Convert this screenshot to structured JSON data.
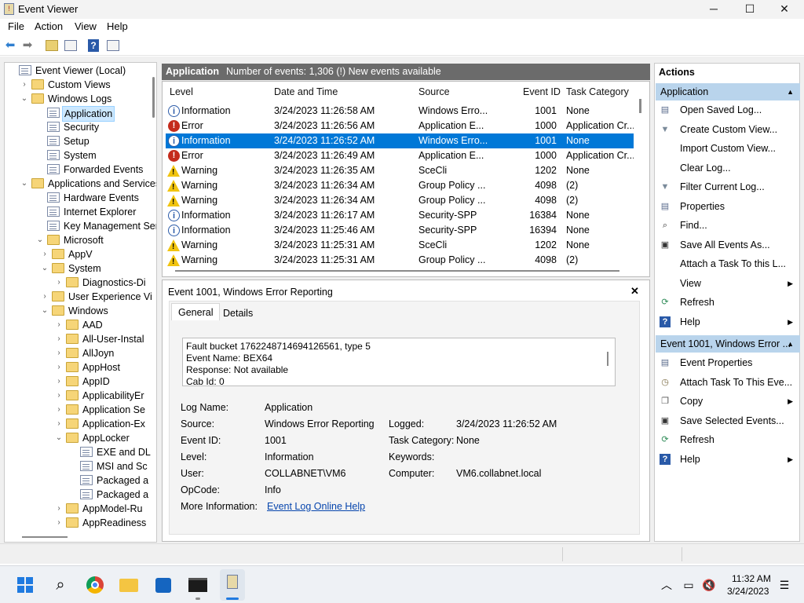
{
  "window": {
    "title": "Event Viewer",
    "minimize": "─",
    "maximize": "☐",
    "close": "✕"
  },
  "menu": [
    "File",
    "Action",
    "View",
    "Help"
  ],
  "tree": [
    {
      "label": "Event Viewer (Local)",
      "level": 0,
      "chev": "",
      "icon": "log"
    },
    {
      "label": "Custom Views",
      "level": 1,
      "chev": "›",
      "icon": "folder"
    },
    {
      "label": "Windows Logs",
      "level": 1,
      "chev": "⌄",
      "icon": "folder"
    },
    {
      "label": "Application",
      "level": 2,
      "chev": "",
      "icon": "log",
      "selected": true
    },
    {
      "label": "Security",
      "level": 2,
      "chev": "",
      "icon": "log"
    },
    {
      "label": "Setup",
      "level": 2,
      "chev": "",
      "icon": "log"
    },
    {
      "label": "System",
      "level": 2,
      "chev": "",
      "icon": "log"
    },
    {
      "label": "Forwarded Events",
      "level": 2,
      "chev": "",
      "icon": "log"
    },
    {
      "label": "Applications and Services",
      "level": 1,
      "chev": "⌄",
      "icon": "folder"
    },
    {
      "label": "Hardware Events",
      "level": 2,
      "chev": "",
      "icon": "log"
    },
    {
      "label": "Internet Explorer",
      "level": 2,
      "chev": "",
      "icon": "log"
    },
    {
      "label": "Key Management Ser",
      "level": 2,
      "chev": "",
      "icon": "log"
    },
    {
      "label": "Microsoft",
      "level": 2,
      "chev": "⌄",
      "icon": "folder"
    },
    {
      "label": "AppV",
      "level": 3,
      "chev": "›",
      "icon": "folder"
    },
    {
      "label": "System",
      "level": 3,
      "chev": "⌄",
      "icon": "folder"
    },
    {
      "label": "Diagnostics-Di",
      "level": 4,
      "chev": "›",
      "icon": "folder"
    },
    {
      "label": "User Experience Vi",
      "level": 3,
      "chev": "›",
      "icon": "folder"
    },
    {
      "label": "Windows",
      "level": 3,
      "chev": "⌄",
      "icon": "folder"
    },
    {
      "label": "AAD",
      "level": 4,
      "chev": "›",
      "icon": "folder"
    },
    {
      "label": "All-User-Instal",
      "level": 4,
      "chev": "›",
      "icon": "folder"
    },
    {
      "label": "AllJoyn",
      "level": 4,
      "chev": "›",
      "icon": "folder"
    },
    {
      "label": "AppHost",
      "level": 4,
      "chev": "›",
      "icon": "folder"
    },
    {
      "label": "AppID",
      "level": 4,
      "chev": "›",
      "icon": "folder"
    },
    {
      "label": "ApplicabilityEr",
      "level": 4,
      "chev": "›",
      "icon": "folder"
    },
    {
      "label": "Application Se",
      "level": 4,
      "chev": "›",
      "icon": "folder"
    },
    {
      "label": "Application-Ex",
      "level": 4,
      "chev": "›",
      "icon": "folder"
    },
    {
      "label": "AppLocker",
      "level": 4,
      "chev": "⌄",
      "icon": "folder"
    },
    {
      "label": "EXE and DL",
      "level": 5,
      "chev": "",
      "icon": "log"
    },
    {
      "label": "MSI and Sc",
      "level": 5,
      "chev": "",
      "icon": "log"
    },
    {
      "label": "Packaged a",
      "level": 5,
      "chev": "",
      "icon": "log"
    },
    {
      "label": "Packaged a",
      "level": 5,
      "chev": "",
      "icon": "log"
    },
    {
      "label": "AppModel-Ru",
      "level": 4,
      "chev": "›",
      "icon": "folder"
    },
    {
      "label": "AppReadiness",
      "level": 4,
      "chev": "›",
      "icon": "folder"
    }
  ],
  "center": {
    "log_name": "Application",
    "summary": "Number of events: 1,306 (!) New events available",
    "columns": {
      "level": "Level",
      "date": "Date and Time",
      "source": "Source",
      "event_id": "Event ID",
      "task": "Task Category"
    },
    "rows": [
      {
        "type": "info",
        "level": "Information",
        "date": "3/24/2023 11:26:58 AM",
        "source": "Windows Erro...",
        "id": "1001",
        "task": "None"
      },
      {
        "type": "err",
        "level": "Error",
        "date": "3/24/2023 11:26:56 AM",
        "source": "Application E...",
        "id": "1000",
        "task": "Application Cr..."
      },
      {
        "type": "info",
        "level": "Information",
        "date": "3/24/2023 11:26:52 AM",
        "source": "Windows Erro...",
        "id": "1001",
        "task": "None",
        "selected": true
      },
      {
        "type": "err",
        "level": "Error",
        "date": "3/24/2023 11:26:49 AM",
        "source": "Application E...",
        "id": "1000",
        "task": "Application Cr..."
      },
      {
        "type": "warn",
        "level": "Warning",
        "date": "3/24/2023 11:26:35 AM",
        "source": "SceCli",
        "id": "1202",
        "task": "None"
      },
      {
        "type": "warn",
        "level": "Warning",
        "date": "3/24/2023 11:26:34 AM",
        "source": "Group Policy ...",
        "id": "4098",
        "task": "(2)"
      },
      {
        "type": "warn",
        "level": "Warning",
        "date": "3/24/2023 11:26:34 AM",
        "source": "Group Policy ...",
        "id": "4098",
        "task": "(2)"
      },
      {
        "type": "info",
        "level": "Information",
        "date": "3/24/2023 11:26:17 AM",
        "source": "Security-SPP",
        "id": "16384",
        "task": "None"
      },
      {
        "type": "info",
        "level": "Information",
        "date": "3/24/2023 11:25:46 AM",
        "source": "Security-SPP",
        "id": "16394",
        "task": "None"
      },
      {
        "type": "warn",
        "level": "Warning",
        "date": "3/24/2023 11:25:31 AM",
        "source": "SceCli",
        "id": "1202",
        "task": "None"
      },
      {
        "type": "warn",
        "level": "Warning",
        "date": "3/24/2023 11:25:31 AM",
        "source": "Group Policy ...",
        "id": "4098",
        "task": "(2)"
      }
    ]
  },
  "detail": {
    "title": "Event 1001, Windows Error Reporting",
    "close": "✕",
    "tabs": [
      "General",
      "Details"
    ],
    "description": [
      "Fault bucket 1762248714694126561, type 5",
      "Event Name: BEX64",
      "Response: Not available",
      "Cab Id: 0"
    ],
    "fields": {
      "log_name_label": "Log Name:",
      "log_name": "Application",
      "source_label": "Source:",
      "source": "Windows Error Reporting",
      "logged_label": "Logged:",
      "logged": "3/24/2023 11:26:52 AM",
      "event_id_label": "Event ID:",
      "event_id": "1001",
      "task_label": "Task Category:",
      "task": "None",
      "level_label": "Level:",
      "level": "Information",
      "keywords_label": "Keywords:",
      "user_label": "User:",
      "user": "COLLABNET\\VM6",
      "computer_label": "Computer:",
      "computer": "VM6.collabnet.local",
      "opcode_label": "OpCode:",
      "opcode": "Info",
      "more_label": "More Information:",
      "more_link": "Event Log Online Help"
    }
  },
  "actions": {
    "title": "Actions",
    "section1": "Application",
    "items1": [
      {
        "label": "Open Saved Log...",
        "icon": "open-log"
      },
      {
        "label": "Create Custom View...",
        "icon": "filter"
      },
      {
        "label": "Import Custom View...",
        "icon": ""
      },
      {
        "label": "Clear Log...",
        "icon": ""
      },
      {
        "label": "Filter Current Log...",
        "icon": "filter"
      },
      {
        "label": "Properties",
        "icon": "properties"
      },
      {
        "label": "Find...",
        "icon": "find"
      },
      {
        "label": "Save All Events As...",
        "icon": "save"
      },
      {
        "label": "Attach a Task To this L...",
        "icon": ""
      },
      {
        "label": "View",
        "icon": "",
        "submenu": true
      },
      {
        "label": "Refresh",
        "icon": "refresh"
      },
      {
        "label": "Help",
        "icon": "help",
        "submenu": true
      }
    ],
    "section2": "Event 1001, Windows Error ...",
    "items2": [
      {
        "label": "Event Properties",
        "icon": "properties"
      },
      {
        "label": "Attach Task To This Eve...",
        "icon": "task"
      },
      {
        "label": "Copy",
        "icon": "copy",
        "submenu": true
      },
      {
        "label": "Save Selected Events...",
        "icon": "save"
      },
      {
        "label": "Refresh",
        "icon": "refresh"
      },
      {
        "label": "Help",
        "icon": "help",
        "submenu": true
      }
    ]
  },
  "taskbar": {
    "time": "11:32 AM",
    "date": "3/24/2023"
  }
}
